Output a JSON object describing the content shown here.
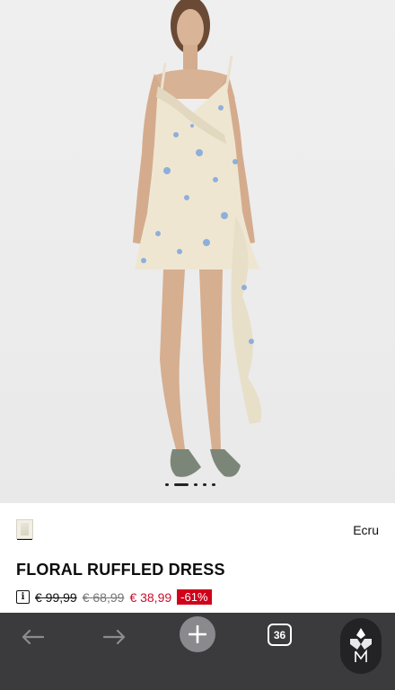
{
  "product": {
    "color_name": "Ecru",
    "title": "FLORAL RUFFLED DRESS",
    "price_original": "€ 99,99",
    "price_previous": "€ 68,99",
    "price_current": "€ 38,99",
    "discount": "-61%",
    "info_icon_glyph": "i"
  },
  "gallery": {
    "image_count_dots": 5,
    "active_index": 1
  },
  "toolbar": {
    "tab_count": "36",
    "icons": [
      "arrow-left-icon",
      "arrow-right-icon",
      "plus-icon",
      "tab-counter-icon",
      "brand-logo-icon"
    ]
  },
  "colors": {
    "sale": "#c8102e",
    "discount_badge": "#d0021b",
    "toolbar_bg": "#3b3b3d"
  }
}
